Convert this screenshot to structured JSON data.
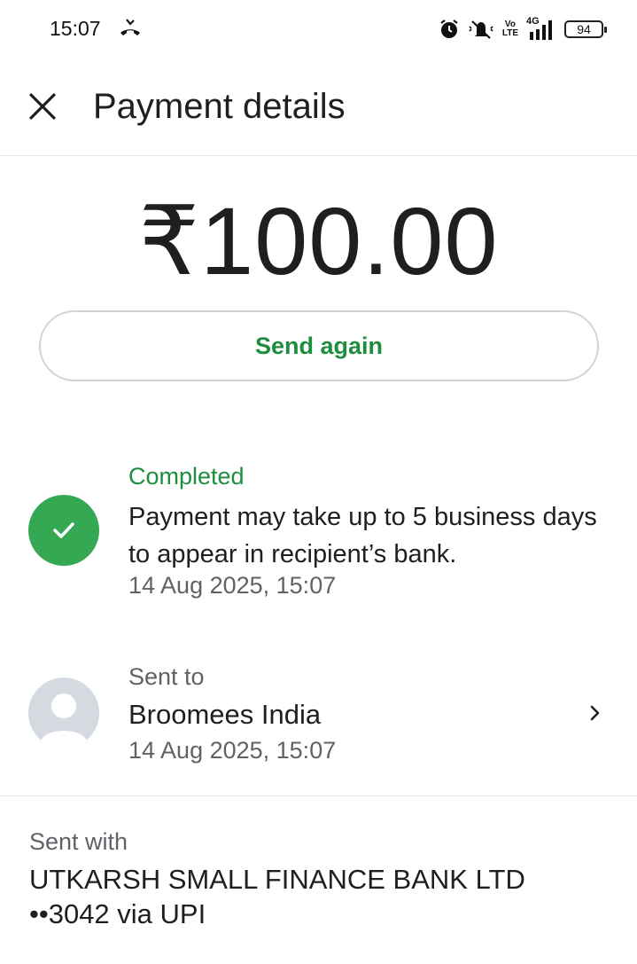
{
  "status_bar": {
    "time": "15:07",
    "volte_top": "Vo",
    "volte_bottom": "LTE",
    "network": "4G",
    "battery": "94"
  },
  "header": {
    "title": "Payment details"
  },
  "payment": {
    "amount": "₹100.00",
    "send_again_label": "Send again"
  },
  "status": {
    "label": "Completed",
    "message": "Payment may take up to 5 business days to appear in recipient’s bank.",
    "timestamp": "14 Aug 2025, 15:07"
  },
  "recipient": {
    "label": "Sent to",
    "name": "Broomees India",
    "timestamp": "14 Aug 2025, 15:07"
  },
  "sent_with": {
    "label": "Sent with",
    "bank": "UTKARSH SMALL FINANCE BANK LTD",
    "account": "••3042 via UPI"
  },
  "colors": {
    "accent_green": "#1e8e3e",
    "check_green": "#34a853",
    "secondary_text": "#5f6368"
  },
  "icons": {
    "close": "close-icon",
    "check": "check-icon",
    "avatar": "person-icon",
    "chevron": "chevron-right-icon"
  }
}
